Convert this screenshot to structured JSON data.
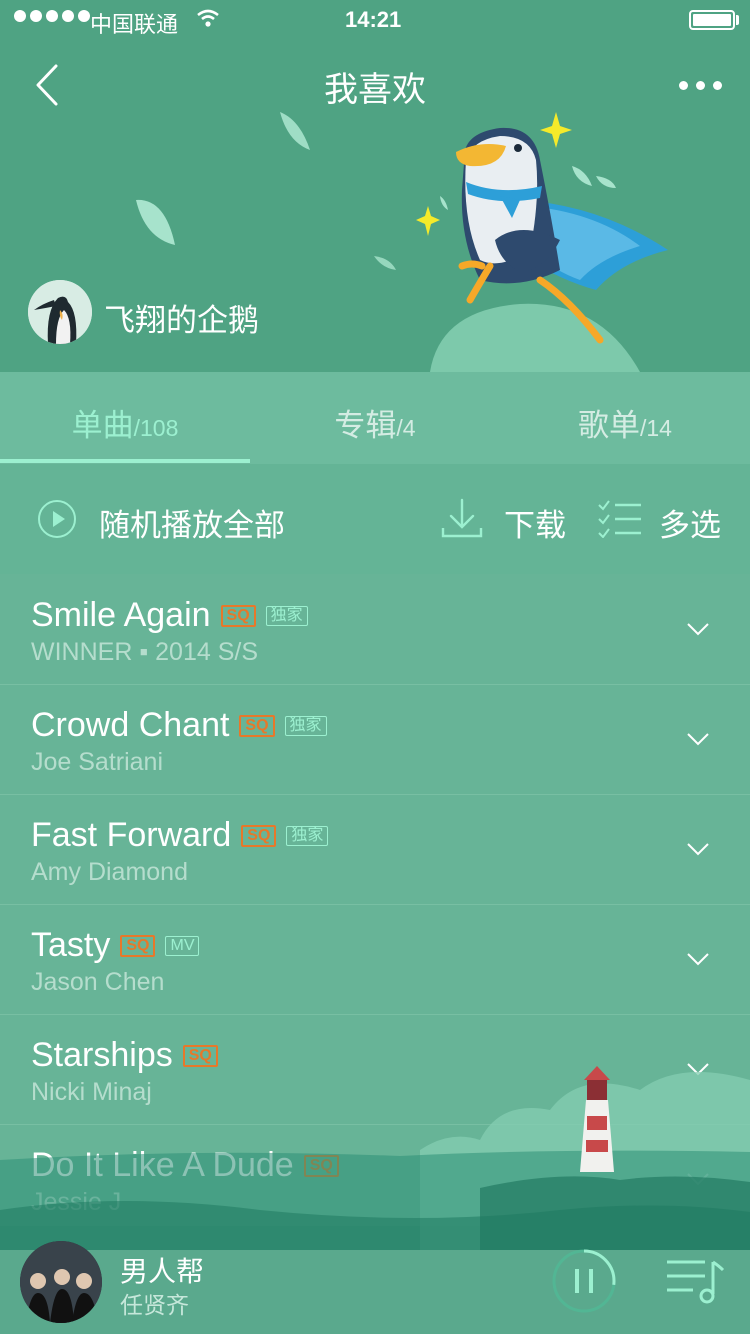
{
  "status_bar": {
    "carrier": "中国联通",
    "time": "14:21"
  },
  "header": {
    "title": "我喜欢",
    "username": "飞翔的企鹅"
  },
  "tabs": [
    {
      "label": "单曲",
      "count": "/108"
    },
    {
      "label": "专辑",
      "count": "/4"
    },
    {
      "label": "歌单",
      "count": "/14"
    }
  ],
  "actions": {
    "play_all": "随机播放全部",
    "download": "下载",
    "multi_select": "多选"
  },
  "songs": [
    {
      "title": "Smile Again",
      "subtitle": "WINNER ▪ 2014 S/S",
      "tags": [
        "SQ",
        "独家"
      ]
    },
    {
      "title": "Crowd Chant",
      "subtitle": "Joe Satriani",
      "tags": [
        "SQ",
        "独家"
      ]
    },
    {
      "title": "Fast Forward",
      "subtitle": "Amy Diamond",
      "tags": [
        "SQ",
        "独家"
      ]
    },
    {
      "title": "Tasty",
      "subtitle": "Jason Chen",
      "tags": [
        "SQ",
        "MV"
      ]
    },
    {
      "title": "Starships",
      "subtitle": "Nicki Minaj",
      "tags": [
        "SQ"
      ]
    },
    {
      "title": "Do It Like A Dude",
      "subtitle": "Jessie J",
      "tags": [
        "SQ"
      ]
    }
  ],
  "player": {
    "title": "男人帮",
    "artist": "任贤齐",
    "progress": 0.27
  },
  "colors": {
    "accent": "#9cf0d0",
    "sq_tag": "#e7782a",
    "header_bg": "#4fa383"
  }
}
